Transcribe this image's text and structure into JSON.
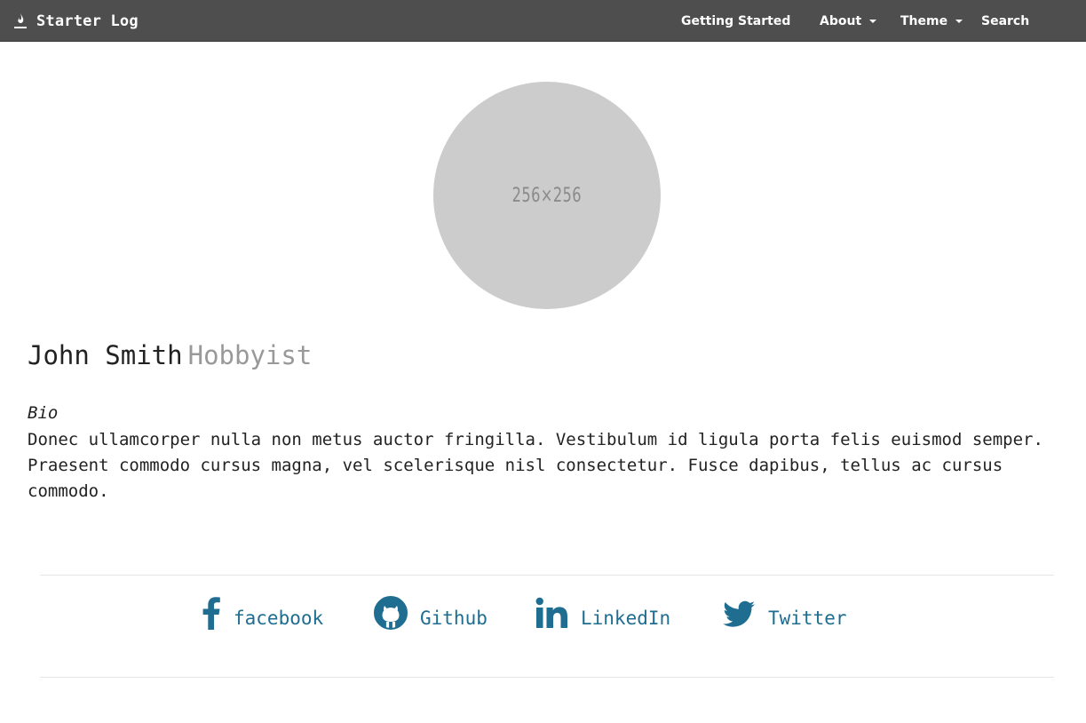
{
  "navbar": {
    "brand": "Starter Log",
    "brand_icon": "flame-icon",
    "items": [
      {
        "label": "Getting Started",
        "dropdown": false
      },
      {
        "label": "About",
        "dropdown": true
      },
      {
        "label": "Theme",
        "dropdown": true
      },
      {
        "label": "Search",
        "dropdown": false
      }
    ]
  },
  "profile": {
    "avatar_placeholder": "256×256",
    "name": "John Smith",
    "role": "Hobbyist",
    "bio_label": "Bio",
    "bio_text": "Donec ullamcorper nulla non metus auctor fringilla. Vestibulum id ligula porta felis euismod semper. Praesent commodo cursus magna, vel scelerisque nisl consectetur. Fusce dapibus, tellus ac cursus commodo."
  },
  "social": [
    {
      "label": "facebook",
      "icon": "facebook-icon"
    },
    {
      "label": "Github",
      "icon": "github-icon"
    },
    {
      "label": "LinkedIn",
      "icon": "linkedin-icon"
    },
    {
      "label": "Twitter",
      "icon": "twitter-icon"
    }
  ],
  "colors": {
    "navbar_bg": "#4e4e4e",
    "link": "#1f6e91",
    "avatar_bg": "#cccccc",
    "muted": "#999999"
  }
}
